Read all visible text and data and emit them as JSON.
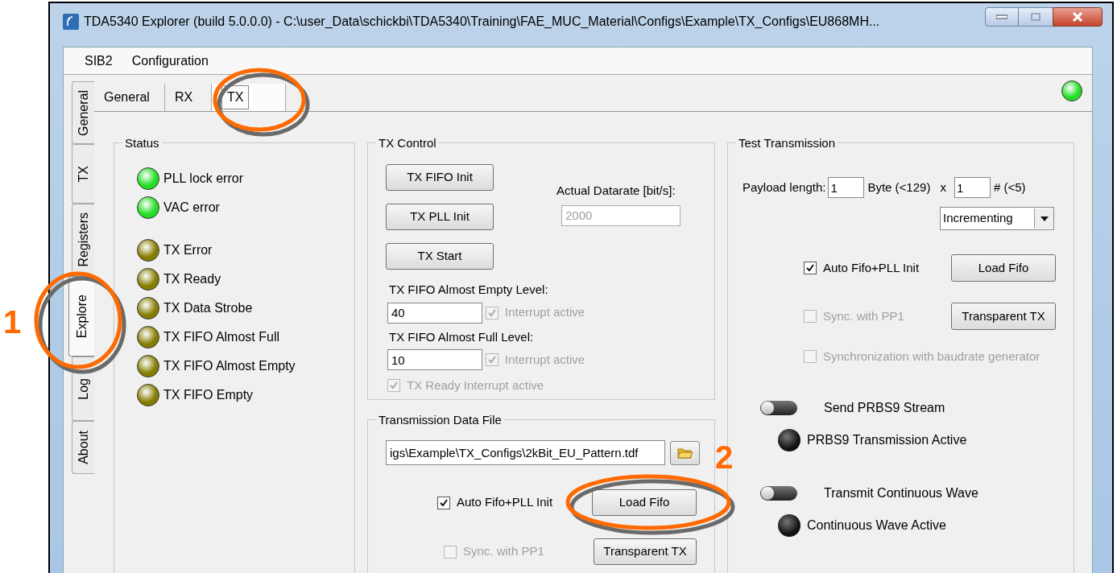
{
  "window": {
    "title": "TDA5340  Explorer (build 5.0.0.0) - C:\\user_Data\\schickbi\\TDA5340\\Training\\FAE_MUC_Material\\Configs\\Example\\TX_Configs\\EU868MH..."
  },
  "menu": [
    "SIB2",
    "Configuration"
  ],
  "side_tabs": [
    {
      "label": "General",
      "selected": false
    },
    {
      "label": "TX",
      "selected": false
    },
    {
      "label": "Registers",
      "selected": false
    },
    {
      "label": "Explore",
      "selected": true
    },
    {
      "label": "Log",
      "selected": false
    },
    {
      "label": "About",
      "selected": false
    }
  ],
  "tabs": [
    {
      "label": "General",
      "selected": false
    },
    {
      "label": "RX",
      "selected": false
    },
    {
      "label": "TX",
      "selected": true
    }
  ],
  "connection_led": {
    "color": "#22dd22"
  },
  "status": {
    "title": "Status",
    "groups": [
      [
        {
          "label": "PLL lock error",
          "color": "#22dd22"
        },
        {
          "label": "VAC error",
          "color": "#22dd22"
        }
      ],
      [
        {
          "label": "TX Error",
          "color": "#857d00"
        },
        {
          "label": "TX Ready",
          "color": "#857d00"
        },
        {
          "label": "TX Data Strobe",
          "color": "#857d00"
        },
        {
          "label": "TX FIFO Almost Full",
          "color": "#857d00"
        },
        {
          "label": "TX FIFO Almost Empty",
          "color": "#857d00"
        },
        {
          "label": "TX FIFO Empty",
          "color": "#857d00"
        }
      ]
    ]
  },
  "tx_control": {
    "title": "TX Control",
    "buttons": [
      "TX FIFO Init",
      "TX PLL Init",
      "TX Start"
    ],
    "datarate": {
      "label": "Actual Datarate [bit/s]:",
      "value": "2000",
      "disabled": true
    },
    "levels": [
      {
        "label": "TX FIFO Almost Empty Level:",
        "value": "40",
        "interrupt": {
          "label": "Interrupt active",
          "checked": true,
          "disabled": true
        }
      },
      {
        "label": "TX FIFO Almost Full Level:",
        "value": "10",
        "interrupt": {
          "label": "Interrupt active",
          "checked": true,
          "disabled": true
        }
      }
    ],
    "ready_interrupt": {
      "label": "TX Ready Interrupt active",
      "checked": true,
      "disabled": true
    }
  },
  "data_file": {
    "title": "Transmission Data File",
    "path": "igs\\Example\\TX_Configs\\2kBit_EU_Pattern.tdf",
    "auto_init": {
      "label": "Auto Fifo+PLL Init",
      "checked": true,
      "disabled": false
    },
    "load_button": "Load Fifo",
    "sync": {
      "label": "Sync. with PP1",
      "checked": false,
      "disabled": true
    },
    "transparent_button": "Transparent TX"
  },
  "test_transmission": {
    "title": "Test Transmission",
    "payload_label": "Payload length:",
    "payload_value": "1",
    "byte_label": "Byte (<129)",
    "times": "x",
    "count_value": "1",
    "count_label": "# (<5)",
    "pattern": "Incrementing",
    "auto_init": {
      "label": "Auto Fifo+PLL Init",
      "checked": true,
      "disabled": false
    },
    "load_button": "Load Fifo",
    "sync": {
      "label": "Sync. with PP1",
      "checked": false,
      "disabled": true
    },
    "transparent_button": "Transparent TX",
    "baud_sync": {
      "label": "Synchronization with baudrate generator",
      "checked": false,
      "disabled": true
    },
    "streams": [
      {
        "switch_label": "Send PRBS9 Stream",
        "on": false,
        "indicator_label": "PRBS9 Transmission Active",
        "active": false
      },
      {
        "switch_label": "Transmit Continuous Wave",
        "on": false,
        "indicator_label": "Continuous Wave Active",
        "active": false
      }
    ]
  },
  "annotations": [
    {
      "number": "1"
    },
    {
      "number": "2"
    }
  ]
}
